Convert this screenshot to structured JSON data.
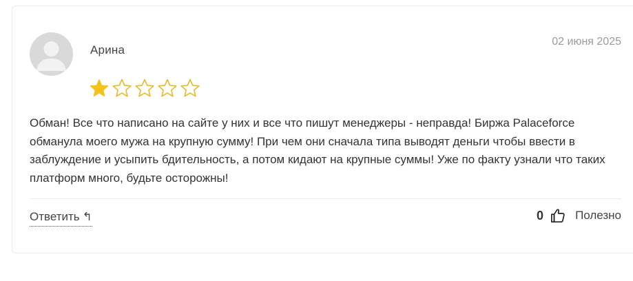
{
  "review": {
    "author": "Арина",
    "date": "02 июня 2025",
    "rating": 1,
    "max_rating": 5,
    "text": "Обман! Все что написано на сайте у них и все что пишут менеджеры - неправда! Биржа Palaceforce обманула моего мужа на крупную сумму! При чем они сначала типа выводят деньги чтобы ввести в заблуждение и усыпить бдительность, а потом кидают на крупные суммы! Уже по факту узнали что таких платформ много, будьте осторожны!",
    "reply_label": "Ответить",
    "reply_icon": "↰",
    "useful_count": "0",
    "useful_label": "Полезно"
  },
  "colors": {
    "star_filled": "#f2c31a",
    "star_outline": "#e4bb2c",
    "avatar_bg": "#d9d9d9",
    "avatar_fg": "#f2f2f2",
    "date_text": "#9a9a9a"
  },
  "icons": {
    "avatar": "user-silhouette-icon",
    "star": "star-icon",
    "reply": "reply-arrow-icon",
    "thumb": "thumbs-up-icon"
  }
}
